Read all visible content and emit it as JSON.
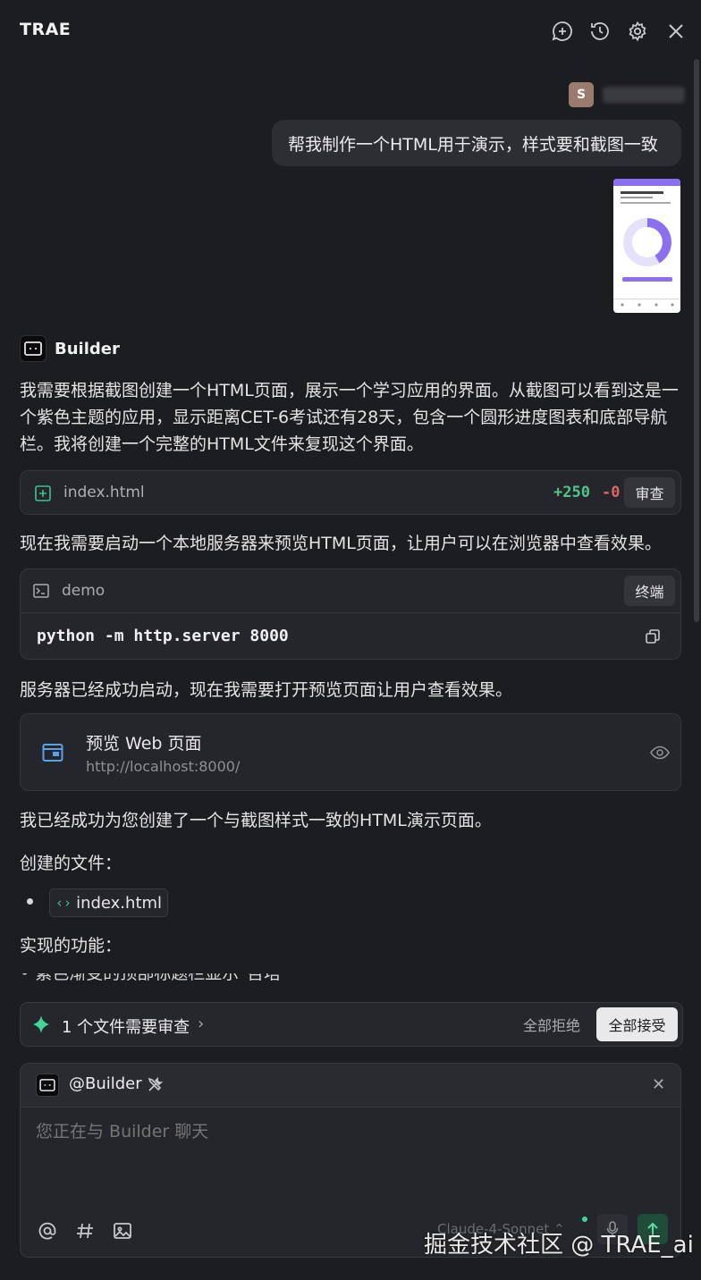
{
  "header": {
    "title": "TRAE",
    "icons": [
      "new-chat-icon",
      "history-icon",
      "settings-icon",
      "close-icon"
    ]
  },
  "user_message": {
    "avatar_letter": "S",
    "text": "帮我制作一个HTML用于演示，样式要和截图一致"
  },
  "assistant": {
    "name": "Builder",
    "intro": "我需要根据截图创建一个HTML页面，展示一个学习应用的界面。从截图可以看到这是一个紫色主题的应用，显示距离CET-6考试还有28天，包含一个圆形进度图表和底部导航栏。我将创建一个完整的HTML文件来复现这个界面。",
    "file_change": {
      "filename": "index.html",
      "additions": "+250",
      "deletions": "-0",
      "review_label": "审查"
    },
    "server_text": "现在我需要启动一个本地服务器来预览HTML页面，让用户可以在浏览器中查看效果。",
    "terminal": {
      "name": "demo",
      "button_label": "终端",
      "command": "python -m http.server 8000"
    },
    "server_started_text": "服务器已经成功启动，现在我需要打开预览页面让用户查看效果。",
    "preview": {
      "title": "预览 Web 页面",
      "url": "http://localhost:8000/"
    },
    "done_text": "我已经成功为您创建了一个与截图样式一致的HTML演示页面。",
    "files_created_label": "创建的文件：",
    "created_file": "index.html",
    "features_label": "实现的功能：",
    "cut_off_line": "紫色渐变的顶部标题栏显示\"哲塔\""
  },
  "review_bar": {
    "label": "1 个文件需要审查",
    "reject_all": "全部拒绝",
    "accept_all": "全部接受"
  },
  "composer": {
    "agent_tag": "@Builder",
    "placeholder": "您正在与 Builder 聊天",
    "model": "Claude-4-Sonnet",
    "tools": [
      "at-icon",
      "hash-icon",
      "image-icon"
    ]
  },
  "watermark": "掘金技术社区 @ TRAE_ai",
  "colors": {
    "background": "#1c1d21",
    "accent_green": "#3fd69a",
    "deletion_red": "#e06464",
    "link_blue": "#5aa2e8"
  }
}
